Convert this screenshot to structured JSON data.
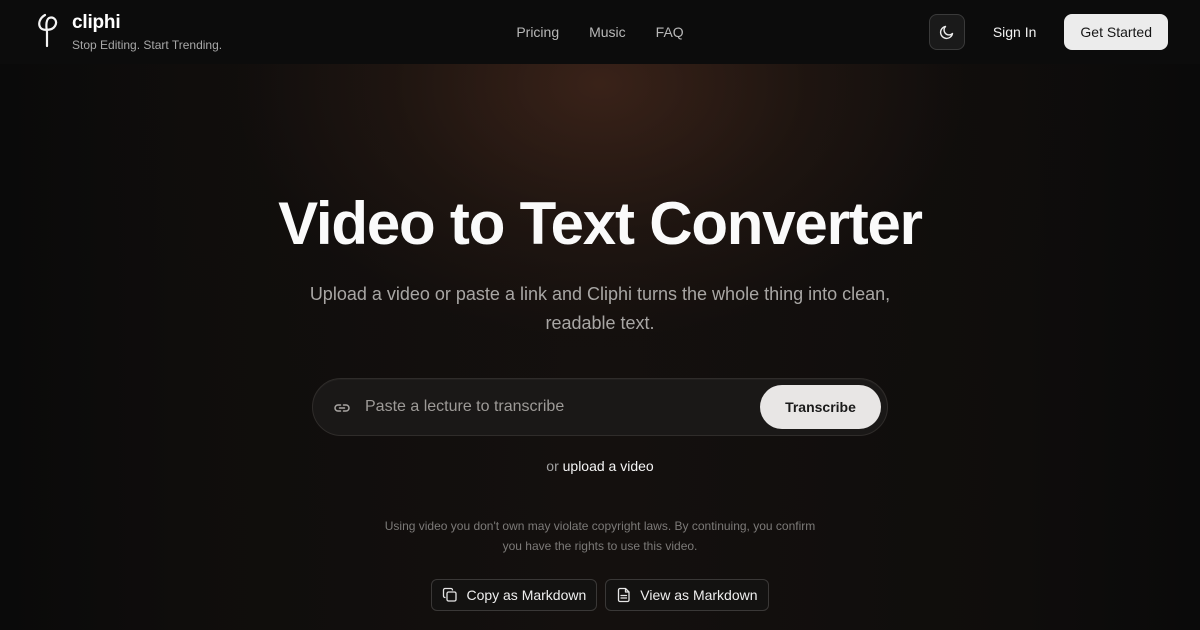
{
  "header": {
    "brand": "cliphi",
    "tagline": "Stop Editing. Start Trending.",
    "nav_links": [
      "Pricing",
      "Music",
      "FAQ"
    ],
    "theme_toggle_icon": "moon-icon",
    "signin_label": "Sign In",
    "get_started_label": "Get Started"
  },
  "hero": {
    "title": "Video to Text Converter",
    "subtitle": "Upload a video or paste a link and Cliphi turns the whole thing into clean, readable text.",
    "input_placeholder": "Paste a lecture to transcribe",
    "input_value": "",
    "input_icon": "link-icon",
    "transcribe_label": "Transcribe",
    "upload_prefix": "or",
    "upload_link": "upload a video",
    "disclaimer": "Using video you don't own may violate copyright laws. By continuing, you confirm you have the rights to use this video."
  },
  "actions": {
    "copy_markdown_label": "Copy as Markdown",
    "copy_icon": "copy-icon",
    "view_markdown_label": "View as Markdown",
    "view_icon": "document-icon"
  },
  "colors": {
    "background": "#0a0a0a",
    "button_light": "#ececec",
    "glow": "#46281c"
  }
}
